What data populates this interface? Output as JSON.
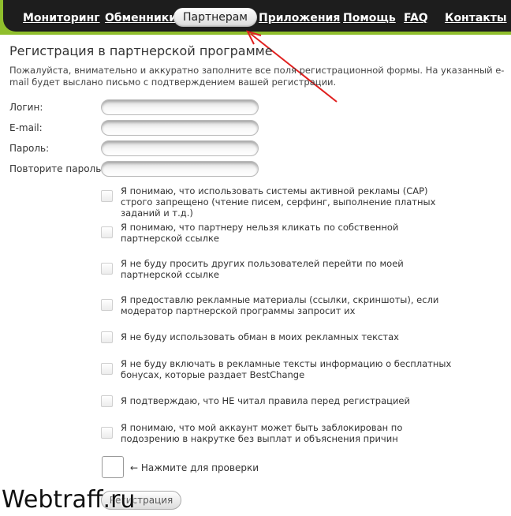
{
  "nav": {
    "items": [
      {
        "label": "Мониторинг"
      },
      {
        "label": "Обменники"
      },
      {
        "label": "Партнерам"
      },
      {
        "label": "Приложения"
      },
      {
        "label": "Помощь"
      },
      {
        "label": "FAQ"
      },
      {
        "label": "Контакты"
      }
    ],
    "active_index": 2,
    "colors": {
      "bar": "#1d1d1d",
      "accent": "#8fbe2c",
      "arrow": "#e0201f"
    }
  },
  "page": {
    "title": "Регистрация в партнерской программе",
    "intro": "Пожалуйста, внимательно и аккуратно заполните все поля регистрационной формы. На указанный e-mail будет выслано письмо с подтверждением вашей регистрации."
  },
  "form": {
    "fields": [
      {
        "label": "Логин:",
        "value": ""
      },
      {
        "label": "E-mail:",
        "value": ""
      },
      {
        "label": "Пароль:",
        "value": ""
      },
      {
        "label": "Повторите пароль:",
        "value": ""
      }
    ],
    "rules": [
      {
        "text": "Я понимаю, что использовать системы активной рекламы (САР) строго запрещено (чтение писем, серфинг, выполнение платных заданий и т.д.)",
        "checked": false
      },
      {
        "text": "Я понимаю, что партнеру нельзя кликать по собственной партнерской ссылке",
        "checked": false
      },
      {
        "text": "Я не буду просить других пользователей перейти по моей партнерской ссылке",
        "checked": false
      },
      {
        "text": "Я предоставлю рекламные материалы (ссылки, скриншоты), если модератор партнерской программы запросит их",
        "checked": false
      },
      {
        "text": "Я не буду использовать обман в моих рекламных текстах",
        "checked": false
      },
      {
        "text": "Я не буду включать в рекламные тексты информацию о бесплатных бонусах, которые раздает BestChange",
        "checked": false
      },
      {
        "text": "Я подтверждаю, что НЕ читал правила перед регистрацией",
        "checked": false
      },
      {
        "text": "Я понимаю, что мой аккаунт может быть заблокирован по подозрению в накрутке без выплат и объяснения причин",
        "checked": false
      }
    ],
    "captcha_hint": "← Нажмите для проверки",
    "submit_label": "Регистрация"
  },
  "watermark": "Webtraff.ru"
}
